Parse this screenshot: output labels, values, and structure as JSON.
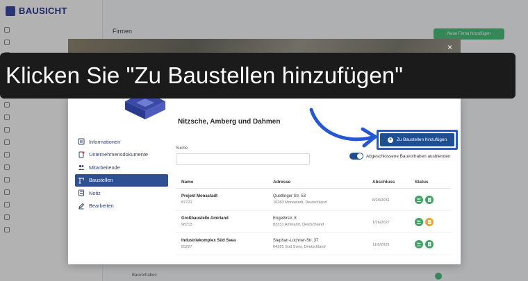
{
  "app": {
    "brand": "BAUSICHT",
    "page_title": "Firmen",
    "header_button": "Neue Firma hinzufügen",
    "bottom_item": "Bauvorhaben"
  },
  "tutorial": {
    "instruction": "Klicken Sie \"Zu Baustellen hinzufügen\""
  },
  "modal": {
    "close": "×",
    "company_name": "Nitzsche, Amberg und Dahmen",
    "nav": [
      {
        "label": "Informationen",
        "icon": "info-icon"
      },
      {
        "label": "Unternehmensdokumente",
        "icon": "document-icon"
      },
      {
        "label": "Mitarbeitende",
        "icon": "people-icon"
      },
      {
        "label": "Baustellen",
        "icon": "crane-icon",
        "active": true
      },
      {
        "label": "Notiz",
        "icon": "note-icon"
      },
      {
        "label": "Bearbeiten",
        "icon": "edit-icon"
      }
    ],
    "search": {
      "label": "Suche",
      "value": "",
      "placeholder": ""
    },
    "add_button": "Zu Baustellen hinzufügen",
    "toggle_label": "Abgeschlossene Bauvorhaben ausblenden",
    "table": {
      "headers": [
        "Name",
        "Adresse",
        "Abschluss",
        "Status"
      ],
      "rows": [
        {
          "name": "Projekt Monastadt",
          "number": "87721",
          "street": "Quettinger Str. 53",
          "city": "10283 Monastadt, Deutschland",
          "date": "8/29/2031"
        },
        {
          "name": "Großbaustelle Amirland",
          "number": "98713",
          "street": "Engelbrstr. 8",
          "city": "83331 Amirland, Deutschland",
          "date": "1/26/2027"
        },
        {
          "name": "Industriekomplex Süd Svea",
          "number": "85227",
          "street": "Stephan-Lochner-Str. 37",
          "city": "64285 Süd Svea, Deutschland",
          "date": "11/8/2029"
        }
      ]
    }
  },
  "colors": {
    "primary": "#1e4f93",
    "highlight": "#2457d6",
    "success": "#3aa760",
    "warning": "#eca534"
  }
}
